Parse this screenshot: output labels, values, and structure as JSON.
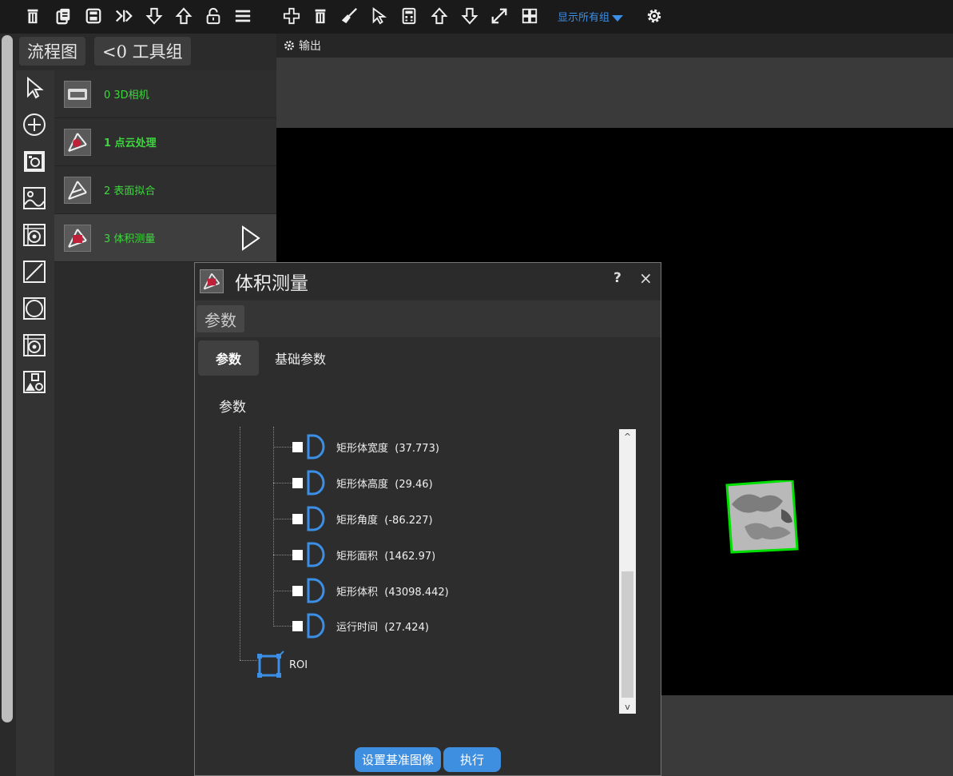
{
  "toolbar": {
    "show_groups_label": "显示所有组",
    "icons": [
      "delete-icon",
      "copy-icon",
      "save-icon",
      "skip-icon",
      "arrow-down-icon",
      "arrow-up-icon",
      "unlock-icon",
      "menu-icon",
      "add-icon",
      "delete-icon",
      "broom-icon",
      "cursor-icon",
      "calculator-icon",
      "arrow-up-icon",
      "arrow-down-icon",
      "expand-icon",
      "grid-icon",
      "gear-icon"
    ]
  },
  "left_panel": {
    "tab_flow": "流程图",
    "tab_toolgroup": "<0 工具组",
    "tools": [
      "cursor-icon",
      "add-circle-icon",
      "camera-image-icon",
      "image-icon",
      "target-icon",
      "line-icon",
      "circle-icon",
      "target-icon",
      "shapes-icon"
    ]
  },
  "flow": [
    {
      "label": "0  3D相机",
      "bold": false
    },
    {
      "label": "1 点云处理",
      "bold": true
    },
    {
      "label": "2 表面拟合",
      "bold": false
    },
    {
      "label": "3 体积测量",
      "bold": false
    }
  ],
  "output": {
    "label": "输出"
  },
  "dialog": {
    "title": "体积测量",
    "help": "?",
    "close": "×",
    "tab_label": "参数",
    "subtabs": [
      "参数",
      "基础参数"
    ],
    "section_label": "参数",
    "tree_items": [
      {
        "name": "矩形体宽度",
        "value": "(37.773)"
      },
      {
        "name": "矩形体高度",
        "value": "(29.46)"
      },
      {
        "name": "矩形角度",
        "value": "(-86.227)"
      },
      {
        "name": "矩形面积",
        "value": "(1462.97)"
      },
      {
        "name": "矩形体积",
        "value": "(43098.442)"
      },
      {
        "name": "运行时间",
        "value": "(27.424)"
      }
    ],
    "roi_label": "ROI",
    "scroll_up": "^",
    "scroll_down": "v",
    "btn_set_ref": "设置基准图像",
    "btn_exec": "执行"
  },
  "colors": {
    "accent": "#3f8fe0",
    "node_text": "#3ed63e",
    "detection_box": "#00e000"
  }
}
